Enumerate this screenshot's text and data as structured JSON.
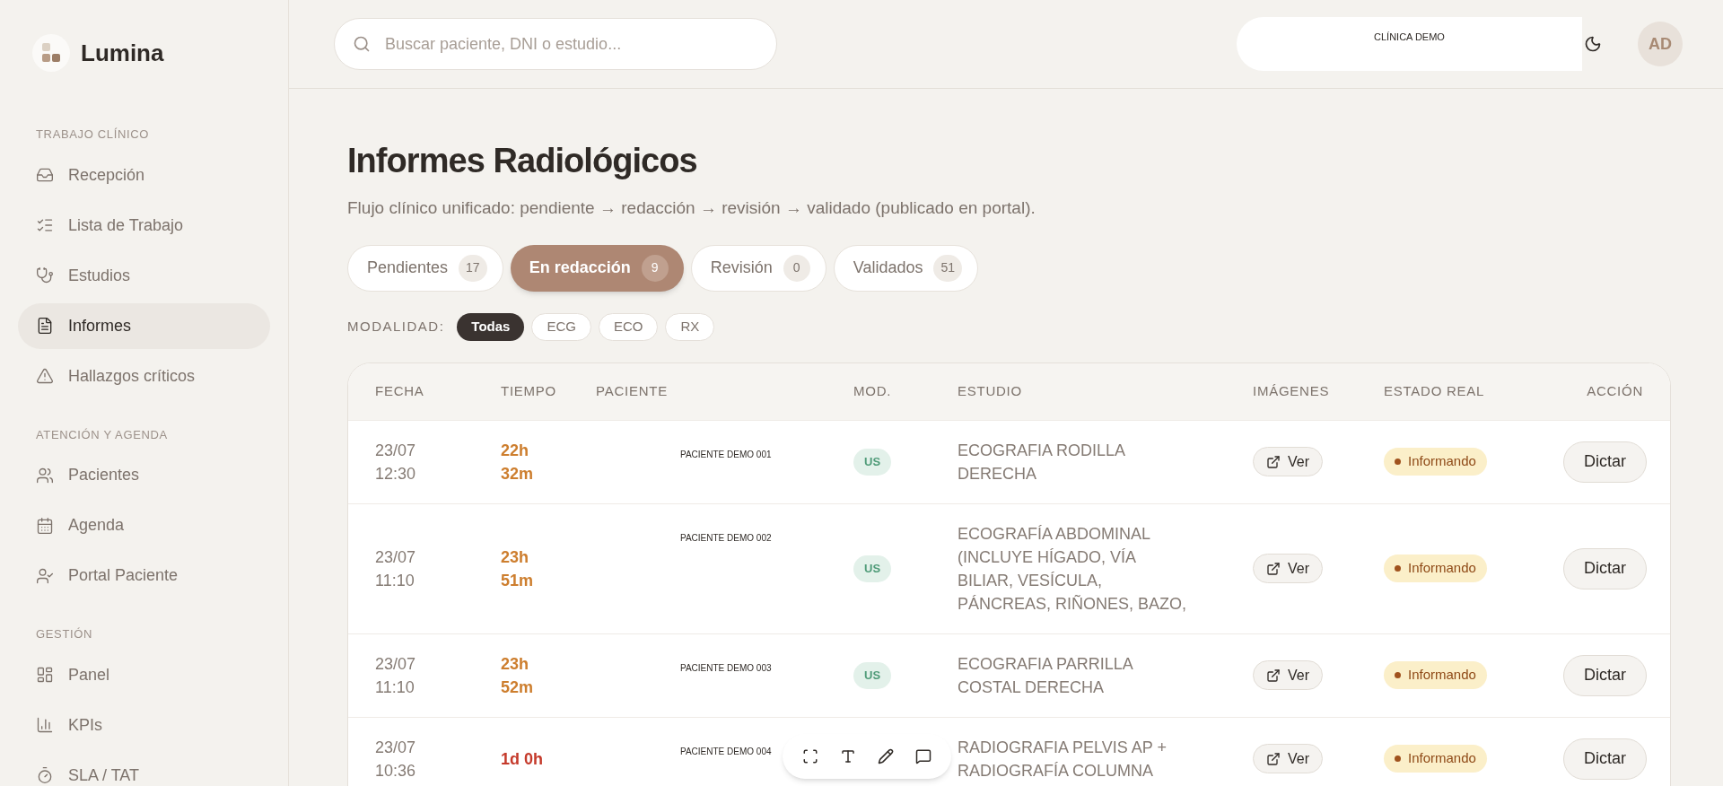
{
  "brand": {
    "name": "Lumina"
  },
  "sidebar": {
    "sections": [
      {
        "title": "TRABAJO CLÍNICO",
        "items": [
          {
            "label": "Recepción",
            "selected": false
          },
          {
            "label": "Lista de Trabajo",
            "selected": false
          },
          {
            "label": "Estudios",
            "selected": false
          },
          {
            "label": "Informes",
            "selected": true
          },
          {
            "label": "Hallazgos críticos",
            "selected": false
          }
        ]
      },
      {
        "title": "ATENCIÓN Y AGENDA",
        "items": [
          {
            "label": "Pacientes",
            "selected": false
          },
          {
            "label": "Agenda",
            "selected": false
          },
          {
            "label": "Portal Paciente",
            "selected": false
          }
        ]
      },
      {
        "title": "GESTIÓN",
        "items": [
          {
            "label": "Panel",
            "selected": false
          },
          {
            "label": "KPIs",
            "selected": false
          },
          {
            "label": "SLA / TAT",
            "selected": false
          }
        ]
      }
    ]
  },
  "topbar": {
    "search": {
      "placeholder": "Buscar paciente, DNI o estudio..."
    },
    "clinic": "CLÍNICA DEMO",
    "avatar": "AD"
  },
  "page": {
    "title": "Informes Radiológicos",
    "subtitle": "Flujo clínico unificado: pendiente → redacción → revisión → validado (publicado en portal)."
  },
  "tabs": [
    {
      "label": "Pendientes",
      "count": "17",
      "selected": false
    },
    {
      "label": "En redacción",
      "count": "9",
      "selected": true
    },
    {
      "label": "Revisión",
      "count": "0",
      "selected": false
    },
    {
      "label": "Validados",
      "count": "51",
      "selected": false
    }
  ],
  "modality_filter": {
    "label": "MODALIDAD:",
    "options": [
      {
        "label": "Todas",
        "selected": true
      },
      {
        "label": "ECG",
        "selected": false
      },
      {
        "label": "ECO",
        "selected": false
      },
      {
        "label": "RX",
        "selected": false
      }
    ]
  },
  "table": {
    "columns": [
      "FECHA",
      "TIEMPO",
      "PACIENTE",
      "MOD.",
      "ESTUDIO",
      "IMÁGENES",
      "ESTADO REAL",
      "ACCIÓN"
    ],
    "rows": [
      {
        "date": "23/07",
        "time": "12:30",
        "elapsed": [
          "22h",
          "32m"
        ],
        "overdue": false,
        "patient": "PACIENTE DEMO 001",
        "mod": "US",
        "study": "ECOGRAFIA RODILLA DERECHA",
        "images": "Ver",
        "status": "Informando",
        "action": "Dictar"
      },
      {
        "date": "23/07",
        "time": "11:10",
        "elapsed": [
          "23h",
          "51m"
        ],
        "overdue": false,
        "patient": "PACIENTE DEMO 002",
        "mod": "US",
        "study": "ECOGRAFÍA ABDOMINAL (INCLUYE HÍGADO, VÍA BILIAR, VESÍCULA, PÁNCREAS, RIÑONES, BAZO,",
        "images": "Ver",
        "status": "Informando",
        "action": "Dictar"
      },
      {
        "date": "23/07",
        "time": "11:10",
        "elapsed": [
          "23h",
          "52m"
        ],
        "overdue": false,
        "patient": "PACIENTE DEMO 003",
        "mod": "US",
        "study": "ECOGRAFIA PARRILLA COSTAL DERECHA",
        "images": "Ver",
        "status": "Informando",
        "action": "Dictar"
      },
      {
        "date": "23/07",
        "time": "10:36",
        "elapsed": [
          "1d 0h"
        ],
        "overdue": true,
        "patient": "PACIENTE DEMO 004",
        "study": "RADIOGRAFIA PELVIS AP + RADIOGRAFÍA COLUMNA",
        "images": "Ver",
        "status": "Informando",
        "action": "Dictar"
      }
    ]
  }
}
